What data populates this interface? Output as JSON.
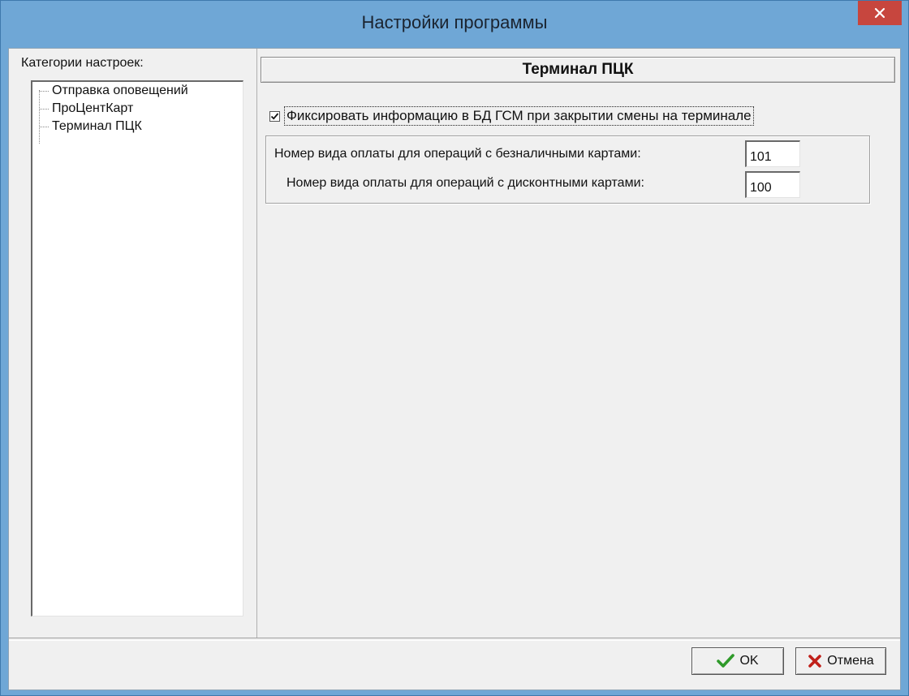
{
  "window": {
    "title": "Настройки программы"
  },
  "left": {
    "label": "Категории настроек:",
    "items": [
      {
        "label": "Отправка оповещений"
      },
      {
        "label": "ПроЦентКарт"
      },
      {
        "label": "Терминал ПЦК"
      }
    ]
  },
  "main": {
    "header": "Терминал ПЦК",
    "checkbox": {
      "label": "Фиксировать информацию в БД ГСМ при закрытии смены на терминале",
      "checked": true
    },
    "fields": [
      {
        "label": "Номер вида оплаты для операций с безналичными картами:",
        "value": "101"
      },
      {
        "label": "Номер вида оплаты для операций с дисконтными картами:",
        "value": "100"
      }
    ]
  },
  "buttons": {
    "ok": {
      "label": "OK",
      "icon": "checkmark-icon",
      "color": "#2f9a2a"
    },
    "cancel": {
      "label": "Отмена",
      "icon": "cross-icon",
      "color": "#c0201a"
    }
  },
  "colors": {
    "titlebar": "#6fa7d6",
    "close": "#c7463e"
  }
}
